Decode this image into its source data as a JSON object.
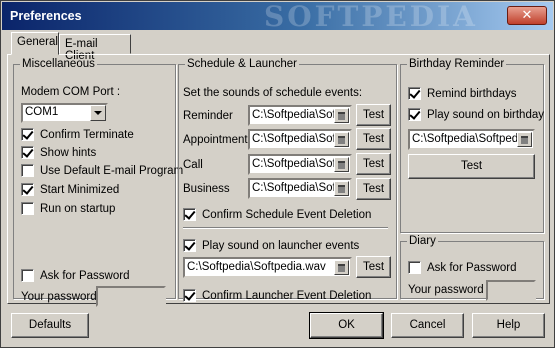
{
  "window": {
    "title": "Preferences",
    "watermark": "SOFTPEDIA",
    "close_glyph": "✕"
  },
  "tabs": [
    "General",
    "E-mail Client"
  ],
  "misc": {
    "legend": "Miscellaneous",
    "modem_label": "Modem COM Port :",
    "modem_value": "COM1",
    "confirm_terminate": "Confirm Terminate",
    "show_hints": "Show hints",
    "use_default_email": "Use Default E-mail Program",
    "start_minimized": "Start Minimized",
    "run_on_startup": "Run on startup",
    "ask_password": "Ask for Password",
    "your_password": "Your password",
    "checked": {
      "confirm_terminate": true,
      "show_hints": true,
      "use_default_email": false,
      "start_minimized": true,
      "run_on_startup": false,
      "ask_password": false
    }
  },
  "schedule": {
    "legend": "Schedule & Launcher",
    "intro": "Set the sounds of schedule events:",
    "events": [
      {
        "label": "Reminder",
        "path": "C:\\Softpedia\\Sof"
      },
      {
        "label": "Appointment",
        "path": "C:\\Softpedia\\Sof"
      },
      {
        "label": "Call",
        "path": "C:\\Softpedia\\Sof"
      },
      {
        "label": "Business",
        "path": "C:\\Softpedia\\Sof"
      }
    ],
    "test_label": "Test",
    "confirm_deletion": "Confirm Schedule Event Deletion",
    "play_launcher": "Play sound on launcher events",
    "launcher_path": "C:\\Softpedia\\Softpedia.wav",
    "confirm_launcher": "Confirm Launcher Event Deletion",
    "checked": {
      "confirm_deletion": true,
      "play_launcher": true,
      "confirm_launcher": true
    }
  },
  "birthday": {
    "legend": "Birthday Reminder",
    "remind": "Remind birthdays",
    "play_sound": "Play sound on birthday",
    "path": "C:\\Softpedia\\Softpedi",
    "test_label": "Test",
    "checked": {
      "remind": true,
      "play_sound": true
    }
  },
  "diary": {
    "legend": "Diary",
    "ask_password": "Ask for Password",
    "your_password": "Your password",
    "checked": {
      "ask_password": false
    }
  },
  "footer": {
    "defaults": "Defaults",
    "ok": "OK",
    "cancel": "Cancel",
    "help": "Help"
  }
}
